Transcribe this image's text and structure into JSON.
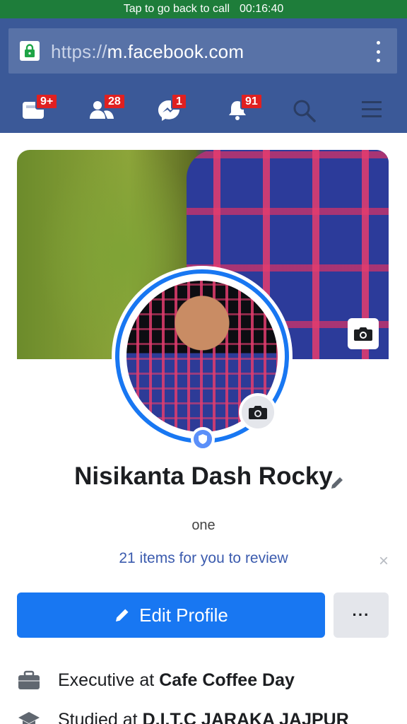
{
  "call_bar": {
    "text": "Tap to go back to call",
    "time": "00:16:40"
  },
  "browser": {
    "scheme": "https://",
    "host": "m.facebook.com"
  },
  "nav": {
    "items": [
      {
        "name": "feed",
        "badge": "9+"
      },
      {
        "name": "friend-requests",
        "badge": "28"
      },
      {
        "name": "messenger",
        "badge": "1"
      },
      {
        "name": "notifications",
        "badge": "91"
      },
      {
        "name": "search",
        "badge": ""
      },
      {
        "name": "menu",
        "badge": ""
      }
    ]
  },
  "profile": {
    "name": "Nisikanta Dash Rocky",
    "bio": "one",
    "review_text": "21 items for you to review",
    "close": "×",
    "edit_label": "Edit Profile",
    "more_label": "···"
  },
  "info": [
    {
      "icon": "briefcase-icon",
      "prefix": "Executive at",
      "value": "Cafe Coffee Day"
    },
    {
      "icon": "graduation-cap-icon",
      "prefix": "Studied at",
      "value": "D.I.T.C JARAKA JAJPUR"
    }
  ],
  "colors": {
    "fb_blue": "#3b5998",
    "button_blue": "#1877f2",
    "call_green": "#1e7d3a"
  }
}
